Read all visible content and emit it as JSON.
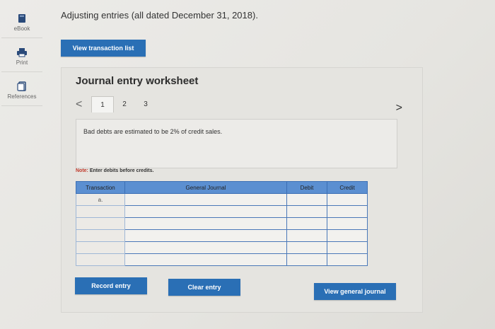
{
  "sidebar": {
    "items": [
      {
        "label": "eBook",
        "icon": "book-icon"
      },
      {
        "label": "Print",
        "icon": "printer-icon"
      },
      {
        "label": "References",
        "icon": "document-icon"
      }
    ]
  },
  "header": {
    "title": "Adjusting entries (all dated December 31, 2018)."
  },
  "buttons": {
    "view_transaction_list": "View transaction list",
    "record_entry": "Record entry",
    "clear_entry": "Clear entry",
    "view_general_journal": "View general journal"
  },
  "worksheet": {
    "title": "Journal entry worksheet",
    "prev_arrow": "<",
    "next_arrow": ">",
    "tabs": [
      "1",
      "2",
      "3"
    ],
    "active_tab": 0,
    "description": "Bad debts are estimated to be 2% of credit sales.",
    "note_prefix": "Note:",
    "note_text": " Enter debits before credits."
  },
  "table": {
    "columns": [
      "Transaction",
      "General Journal",
      "Debit",
      "Credit"
    ],
    "rows": [
      {
        "transaction": "a.",
        "account": "",
        "debit": "",
        "credit": ""
      },
      {
        "transaction": "",
        "account": "",
        "debit": "",
        "credit": ""
      },
      {
        "transaction": "",
        "account": "",
        "debit": "",
        "credit": ""
      },
      {
        "transaction": "",
        "account": "",
        "debit": "",
        "credit": ""
      },
      {
        "transaction": "",
        "account": "",
        "debit": "",
        "credit": ""
      },
      {
        "transaction": "",
        "account": "",
        "debit": "",
        "credit": ""
      }
    ]
  },
  "colors": {
    "accent": "#2a6fb5",
    "table_header": "#5b8fd1"
  }
}
